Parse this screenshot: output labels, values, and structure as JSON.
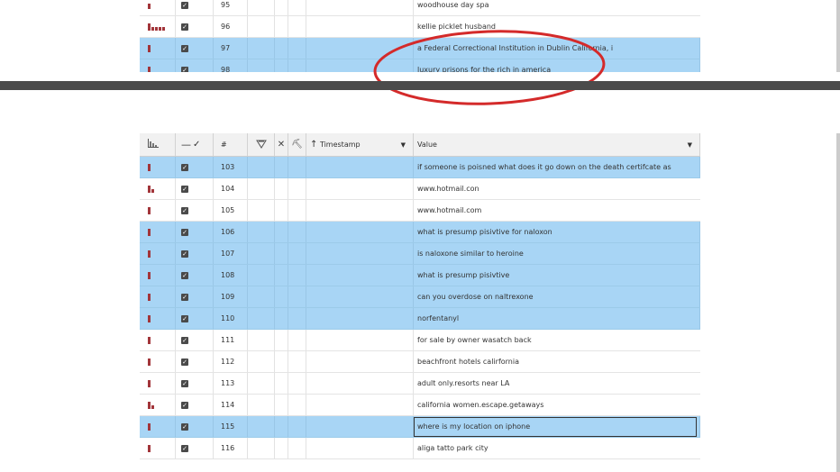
{
  "top_table": {
    "rows": [
      {
        "num": "95",
        "value": "woodhouse day spa",
        "selected": false,
        "bars": [
          6
        ]
      },
      {
        "num": "96",
        "value": "kellie picklet husband",
        "selected": false,
        "bars": [
          8,
          4,
          4,
          4,
          4
        ]
      },
      {
        "num": "97",
        "value": "a Federal Correctional Institution in Dublin California, i",
        "selected": true,
        "bars": [
          8
        ]
      },
      {
        "num": "98",
        "value": "luxury prisons for the rich in america",
        "selected": true,
        "bars": [
          8
        ]
      }
    ]
  },
  "header": {
    "signal_icon": "bar-chart-icon",
    "check_icon": "check-icon",
    "num_label": "#",
    "shield_icon": "shield-icon",
    "close_icon": "close-icon",
    "pick_icon": "pickaxe-icon",
    "timestamp_label": "Timestamp",
    "value_label": "Value"
  },
  "bottom_table": {
    "rows": [
      {
        "num": "103",
        "value": "if someone is poisned what does it go down on the death certifcate as",
        "selected": true,
        "bars": [
          8
        ]
      },
      {
        "num": "104",
        "value": "www.hotmail.con",
        "selected": false,
        "bars": [
          8,
          4
        ]
      },
      {
        "num": "105",
        "value": "www.hotmail.com",
        "selected": false,
        "bars": [
          8
        ]
      },
      {
        "num": "106",
        "value": "what is presump pisivtive for naloxon",
        "selected": true,
        "bars": [
          8
        ]
      },
      {
        "num": "107",
        "value": "is naloxone similar to heroine",
        "selected": true,
        "bars": [
          8
        ]
      },
      {
        "num": "108",
        "value": "what is presump pisivtive",
        "selected": true,
        "bars": [
          8
        ]
      },
      {
        "num": "109",
        "value": "can you overdose on naltrexone",
        "selected": true,
        "bars": [
          8
        ]
      },
      {
        "num": "110",
        "value": "norfentanyl",
        "selected": true,
        "bars": [
          8
        ]
      },
      {
        "num": "111",
        "value": "for sale by owner wasatch back",
        "selected": false,
        "bars": [
          8
        ]
      },
      {
        "num": "112",
        "value": "beachfront hotels calirfornia",
        "selected": false,
        "bars": [
          8
        ]
      },
      {
        "num": "113",
        "value": "adult only.resorts near LA",
        "selected": false,
        "bars": [
          8
        ]
      },
      {
        "num": "114",
        "value": "california women.escape.getaways",
        "selected": false,
        "bars": [
          8,
          4
        ]
      },
      {
        "num": "115",
        "value": "where is my location on iphone",
        "selected": true,
        "bars": [
          8
        ],
        "focused": true
      },
      {
        "num": "116",
        "value": "aliga tatto park city",
        "selected": false,
        "bars": [
          8
        ]
      }
    ]
  },
  "colors": {
    "selection": "#a8d5f5",
    "signal_bar": "#a2353a",
    "annotation_circle": "#d42a2a",
    "divider": "#4b4b4b"
  }
}
